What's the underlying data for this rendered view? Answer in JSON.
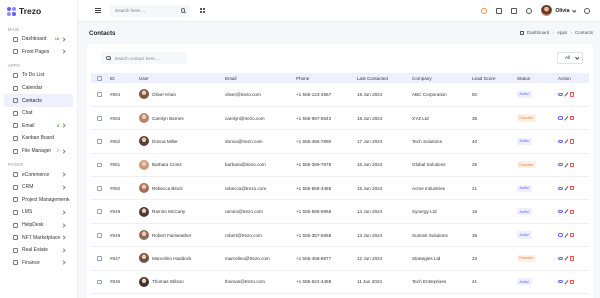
{
  "app": {
    "name": "Trezo"
  },
  "sidebar": {
    "sections": [
      {
        "title": "MAIN",
        "items": [
          {
            "label": "Dashboard",
            "badge": "18",
            "badge_color": "#ff5a29",
            "chevron": true,
            "active": false
          },
          {
            "label": "Front Pages",
            "badge": "",
            "chevron": true,
            "active": false
          }
        ]
      },
      {
        "title": "APPS",
        "items": [
          {
            "label": "To Do List",
            "badge": "",
            "chevron": false,
            "active": false
          },
          {
            "label": "Calendar",
            "badge": "",
            "chevron": false,
            "active": false
          },
          {
            "label": "Contacts",
            "badge": "",
            "chevron": false,
            "active": true
          },
          {
            "label": "Chat",
            "badge": "",
            "chevron": false,
            "active": false
          },
          {
            "label": "Email",
            "badge": "3",
            "badge_color": "#25b003",
            "chevron": true,
            "active": false
          },
          {
            "label": "Kanban Board",
            "badge": "",
            "chevron": false,
            "active": false
          },
          {
            "label": "File Manager",
            "badge": "7",
            "badge_color": "#ff5a29",
            "chevron": true,
            "active": false
          }
        ]
      },
      {
        "title": "PAGES",
        "items": [
          {
            "label": "eCommerce",
            "badge": "",
            "chevron": true,
            "active": false
          },
          {
            "label": "CRM",
            "badge": "",
            "chevron": true,
            "active": false
          },
          {
            "label": "Project Management",
            "badge": "",
            "chevron": true,
            "active": false
          },
          {
            "label": "LMS",
            "badge": "",
            "chevron": true,
            "active": false
          },
          {
            "label": "HelpDesk",
            "badge": "",
            "chevron": true,
            "active": false
          },
          {
            "label": "NFT Marketplace",
            "badge": "",
            "chevron": true,
            "active": false
          },
          {
            "label": "Real Estate",
            "badge": "",
            "chevron": true,
            "active": false
          },
          {
            "label": "Finance",
            "badge": "",
            "chevron": true,
            "active": false
          }
        ]
      }
    ]
  },
  "topbar": {
    "search_placeholder": "Search here.....",
    "user_name": "Olivia"
  },
  "page": {
    "title": "Contacts",
    "breadcrumb": [
      "Dashboard",
      "Apps",
      "Contacts"
    ]
  },
  "table": {
    "search_placeholder": "Search contact here....",
    "filter_value": "All",
    "columns": [
      "ID",
      "User",
      "Email",
      "Phone",
      "Last Contacted",
      "Company",
      "Lead Score",
      "Status",
      "Action"
    ],
    "rows": [
      {
        "id": "#854",
        "user": "Oliver Khan",
        "email": "oliver@trezo.com",
        "phone": "+1 555-123-4567",
        "last": "19 Jun 2024",
        "company": "ABC Corporation",
        "score": "50",
        "status": "Active",
        "avatar": "#7a5545"
      },
      {
        "id": "#853",
        "user": "Carolyn Barnes",
        "email": "carolyn@trezo.com",
        "phone": "+1 555-987-6543",
        "last": "18 Jun 2024",
        "company": "XYZ Ltd",
        "score": "35",
        "status": "Deactive",
        "avatar": "#b9856a"
      },
      {
        "id": "#852",
        "user": "Donna Miller",
        "email": "donna@trezo.com",
        "phone": "+1 555-456-7890",
        "last": "17 Jun 2024",
        "company": "Tech Solutions",
        "score": "40",
        "status": "Active",
        "avatar": "#5b4037"
      },
      {
        "id": "#851",
        "user": "Barbara Cross",
        "email": "barbara@trezo.com",
        "phone": "+1 555-369-7878",
        "last": "16 Jun 2024",
        "company": "Global Solutions",
        "score": "25",
        "status": "Deactive",
        "avatar": "#c79a7f"
      },
      {
        "id": "#850",
        "user": "Rebecca Block",
        "email": "rebecca@trezo.com",
        "phone": "+1 555-658-4488",
        "last": "15 Jun 2024",
        "company": "Acme Industries",
        "score": "21",
        "status": "Active",
        "avatar": "#a8705a"
      },
      {
        "id": "#849",
        "user": "Ramiro McCarty",
        "email": "ramiro@trezo.com",
        "phone": "+1 555-558-9966",
        "last": "14 Jun 2024",
        "company": "Synergy Ltd",
        "score": "15",
        "status": "Active",
        "avatar": "#4a3a35"
      },
      {
        "id": "#849",
        "user": "Robert Fairweather",
        "email": "robert@trezo.com",
        "phone": "+1 555-357-5888",
        "last": "13 Jun 2024",
        "company": "Summit Solutions",
        "score": "36",
        "status": "Active",
        "avatar": "#8b6b5c"
      },
      {
        "id": "#847",
        "user": "Marcelino Haddock",
        "email": "marcelino@trezo.com",
        "phone": "+1 555-456-8877",
        "last": "12 Jun 2024",
        "company": "Strategies Ltd",
        "score": "23",
        "status": "Deactive",
        "avatar": "#6e5046"
      },
      {
        "id": "#846",
        "user": "Thomas Wilson",
        "email": "thomas@trezo.com",
        "phone": "+1 555-622-4488",
        "last": "11 Jun 2024",
        "company": "Tech Enterprises",
        "score": "41",
        "status": "Active",
        "avatar": "#3f3431"
      }
    ]
  }
}
